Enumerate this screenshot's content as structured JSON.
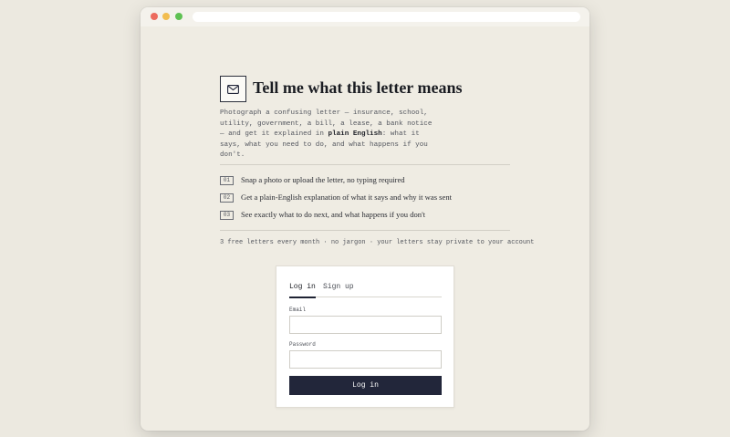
{
  "page": {
    "title": "Tell me what this letter means",
    "logo_icon": "envelope-icon",
    "intro": {
      "part1": "Photograph a confusing letter — insurance, school, utility, government, a bill, a lease, a bank notice — and get it explained in ",
      "highlight": "plain English",
      "part2": ": what it says, what you need to do, and what happens if you don't."
    },
    "steps": [
      {
        "num": "01",
        "text": "Snap a photo or upload the letter, no typing required"
      },
      {
        "num": "02",
        "text": "Get a plain-English explanation of what it says and why it was sent"
      },
      {
        "num": "03",
        "text": "See exactly what to do next, and what happens if you don't"
      }
    ],
    "tagline": "3 free letters every month · no jargon · your letters stay private to your account"
  },
  "auth": {
    "tabs": [
      {
        "label": "Log in",
        "active": true
      },
      {
        "label": "Sign up",
        "active": false
      }
    ],
    "email_label": "Email",
    "email_value": "",
    "password_label": "Password",
    "password_value": "",
    "submit_label": "Log in"
  },
  "colors": {
    "accent": "#22263a",
    "background": "#efece3"
  }
}
